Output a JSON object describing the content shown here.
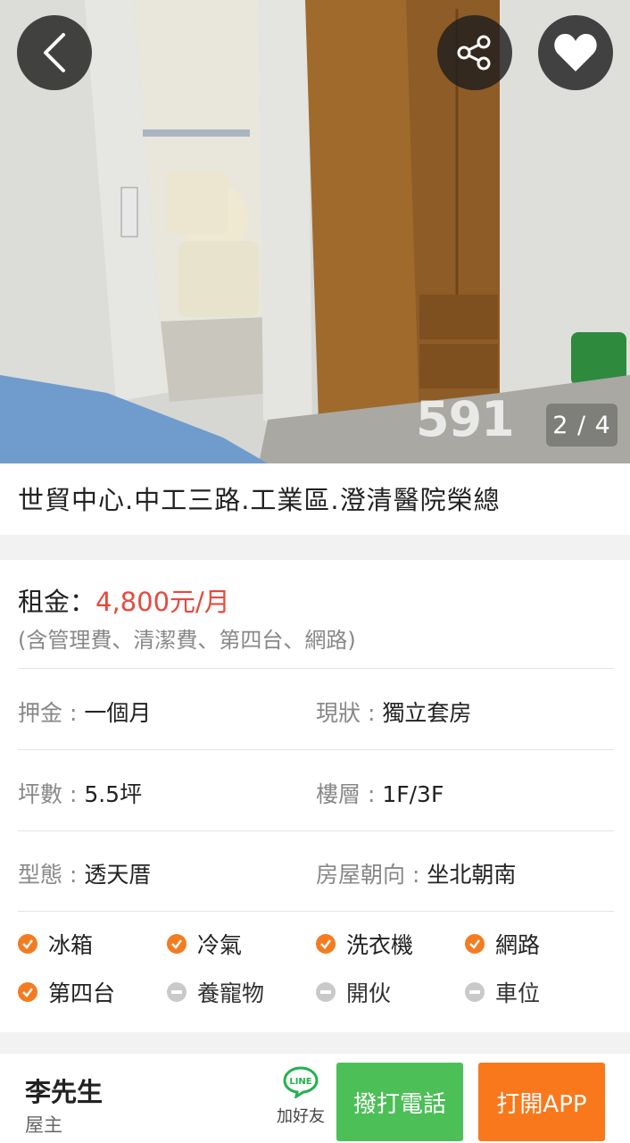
{
  "photo": {
    "counter": "2 / 4",
    "watermark": "591"
  },
  "listing": {
    "title": "世貿中心.中工三路.工業區.澄清醫院榮總"
  },
  "price": {
    "label": "租金：",
    "value": "4,800元/月",
    "note": "(含管理費、清潔費、第四台、網路)",
    "color": "#e64a3b"
  },
  "details": [
    {
      "key": "押金 : ",
      "value": "一個月"
    },
    {
      "key": "現狀 : ",
      "value": "獨立套房"
    },
    {
      "key": "坪數 : ",
      "value": "5.5坪"
    },
    {
      "key": "樓層 : ",
      "value": "1F/3F"
    },
    {
      "key": "型態 : ",
      "value": "透天厝"
    },
    {
      "key": "房屋朝向 : ",
      "value": "坐北朝南"
    }
  ],
  "features": [
    {
      "label": "冰箱",
      "available": true
    },
    {
      "label": "冷氣",
      "available": true
    },
    {
      "label": "洗衣機",
      "available": true
    },
    {
      "label": "網路",
      "available": true
    },
    {
      "label": "第四台",
      "available": true
    },
    {
      "label": "養寵物",
      "available": false
    },
    {
      "label": "開伙",
      "available": false
    },
    {
      "label": "車位",
      "available": false
    }
  ],
  "owner": {
    "name": "李先生",
    "role": "屋主"
  },
  "actions": {
    "line_label": "加好友",
    "line_icon_text": "LINE",
    "call_label": "撥打電話",
    "app_label": "打開APP",
    "call_color": "#4cbf57",
    "app_color": "#f9781c"
  },
  "icons": {
    "back": "chevron-left-icon",
    "share": "share-icon",
    "favorite": "heart-icon"
  }
}
